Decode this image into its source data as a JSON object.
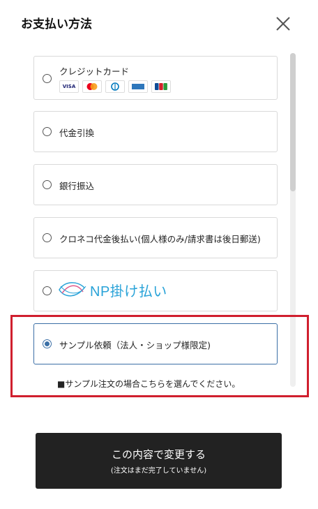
{
  "header": {
    "title": "お支払い方法"
  },
  "options": [
    {
      "label": "クレジットカード",
      "cards": [
        "VISA",
        "MC",
        "DC",
        "AMEX",
        "JCB"
      ]
    },
    {
      "label": "代金引換"
    },
    {
      "label": "銀行振込"
    },
    {
      "label": "クロネコ代金後払い(個人様のみ/請求書は後日郵送)"
    },
    {
      "label": "NP掛け払い"
    },
    {
      "label": "サンプル依頼（法人・ショップ様限定)",
      "selected": true
    }
  ],
  "note": "■サンプル注文の場合こちらを選んでください。",
  "submit": {
    "main": "この内容で変更する",
    "sub": "(注文はまだ完了していません)"
  },
  "colors": {
    "accent": "#3b6fa6",
    "highlight": "#d01f2e",
    "button": "#222222",
    "np": "#2aa3d8"
  },
  "icons": {
    "close": "close-icon"
  }
}
